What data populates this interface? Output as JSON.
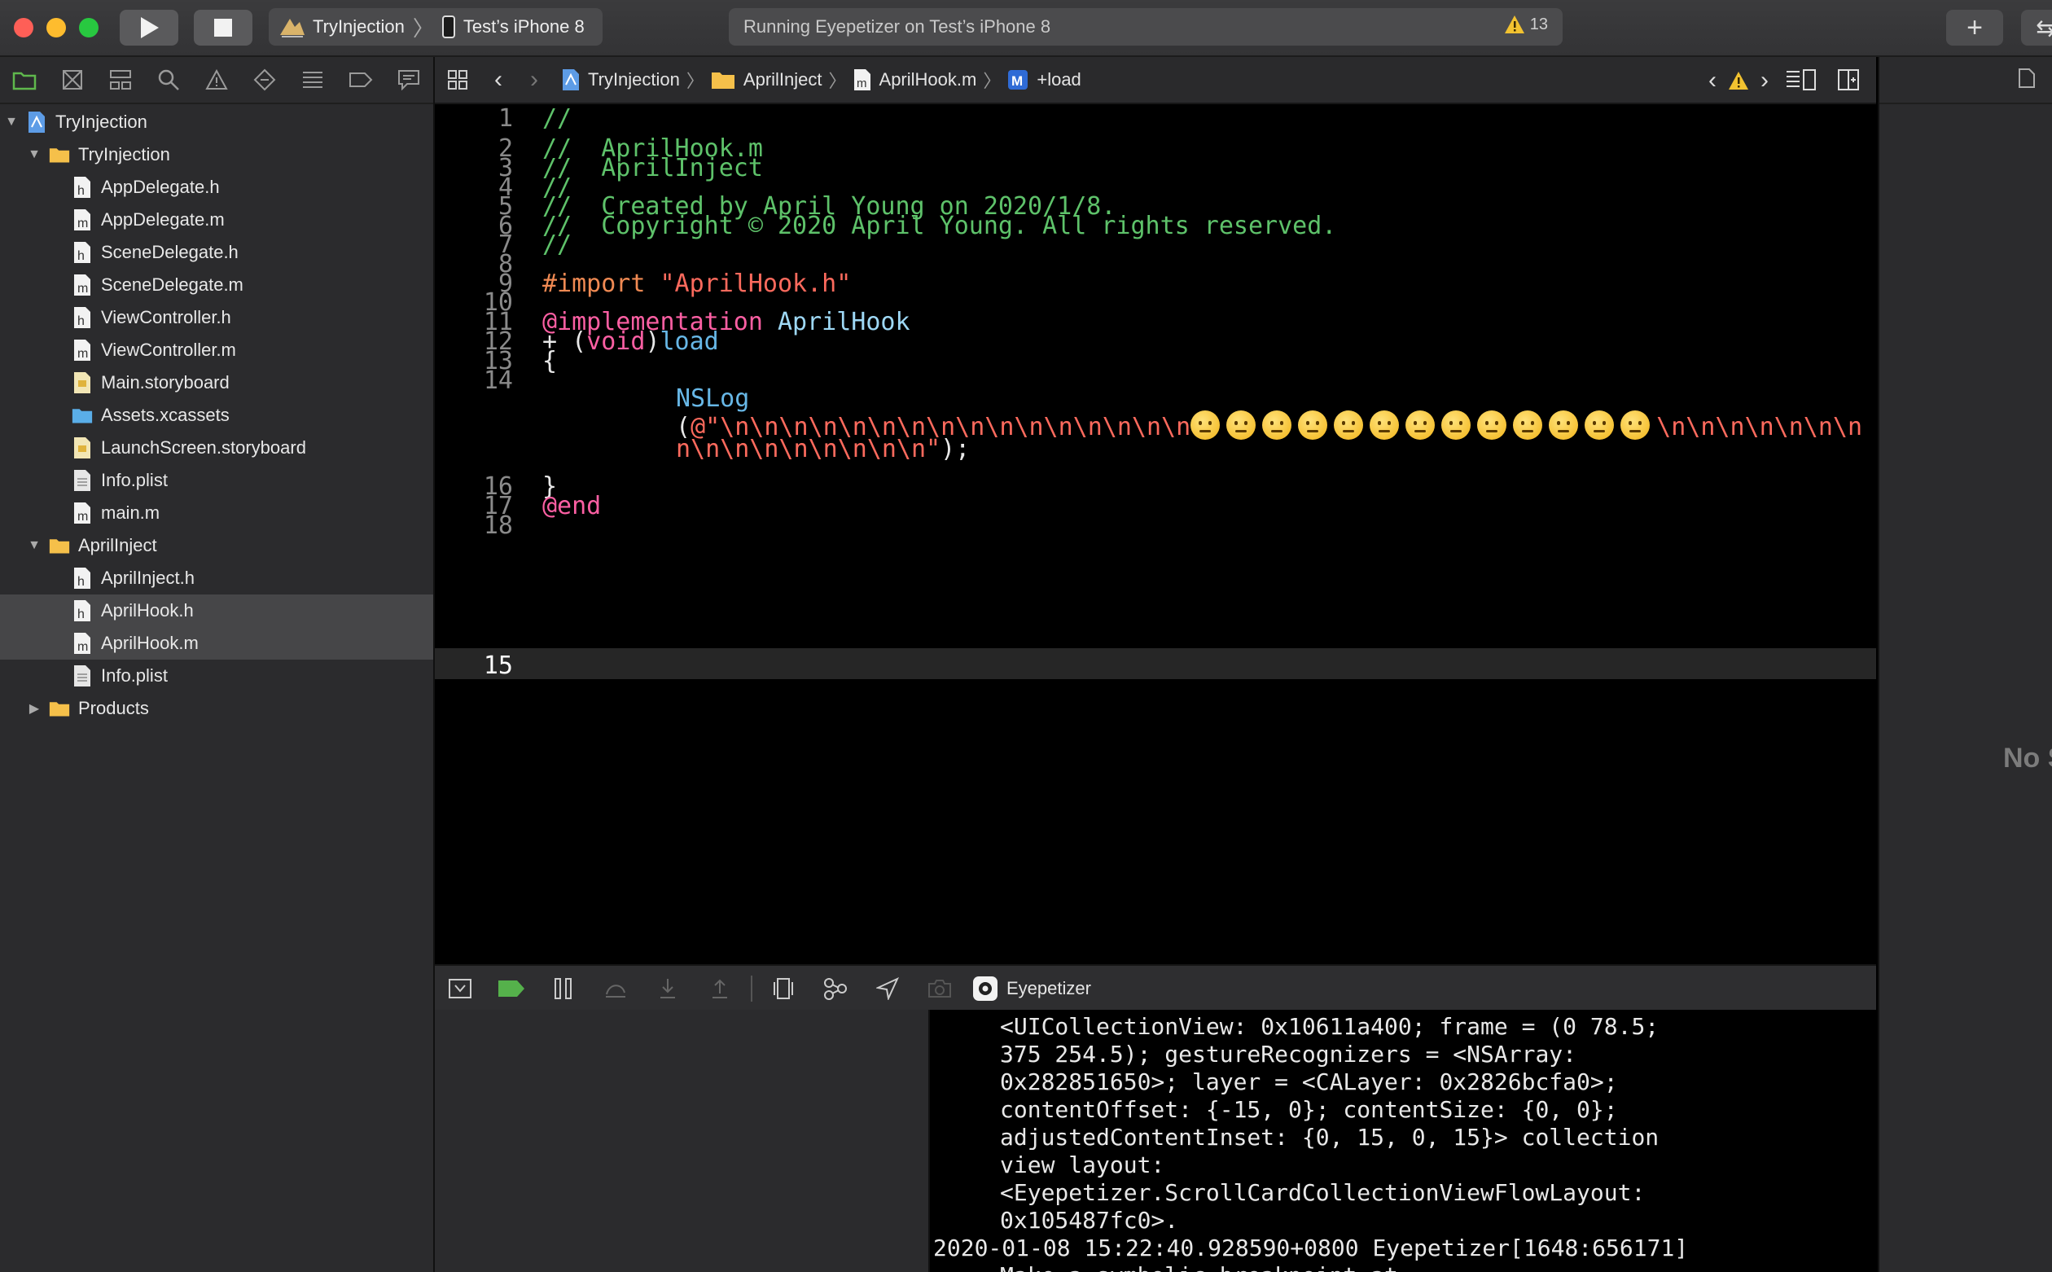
{
  "window": {
    "scheme_target": "TryInjection",
    "scheme_device": "Test’s iPhone 8",
    "activity_text": "Running Eyepetizer on Test’s iPhone 8",
    "warning_count": "13"
  },
  "sidebar": {
    "items": [
      {
        "label": "TryInjection",
        "type": "project",
        "depth": 0,
        "disclosure": "open"
      },
      {
        "label": "TryInjection",
        "type": "folder",
        "depth": 1,
        "disclosure": "open"
      },
      {
        "label": "AppDelegate.h",
        "type": "h",
        "depth": 2
      },
      {
        "label": "AppDelegate.m",
        "type": "m",
        "depth": 2
      },
      {
        "label": "SceneDelegate.h",
        "type": "h",
        "depth": 2
      },
      {
        "label": "SceneDelegate.m",
        "type": "m",
        "depth": 2
      },
      {
        "label": "ViewController.h",
        "type": "h",
        "depth": 2
      },
      {
        "label": "ViewController.m",
        "type": "m",
        "depth": 2
      },
      {
        "label": "Main.storyboard",
        "type": "storyboard",
        "depth": 2
      },
      {
        "label": "Assets.xcassets",
        "type": "assets",
        "depth": 2
      },
      {
        "label": "LaunchScreen.storyboard",
        "type": "storyboard",
        "depth": 2
      },
      {
        "label": "Info.plist",
        "type": "plist",
        "depth": 2
      },
      {
        "label": "main.m",
        "type": "m",
        "depth": 2
      },
      {
        "label": "AprilInject",
        "type": "folder",
        "depth": 1,
        "disclosure": "open"
      },
      {
        "label": "AprilInject.h",
        "type": "h",
        "depth": 2
      },
      {
        "label": "AprilHook.h",
        "type": "h",
        "depth": 2,
        "selected": true
      },
      {
        "label": "AprilHook.m",
        "type": "m",
        "depth": 2,
        "selected": true
      },
      {
        "label": "Info.plist",
        "type": "plist",
        "depth": 2
      },
      {
        "label": "Products",
        "type": "folder",
        "depth": 1,
        "disclosure": "closed"
      }
    ]
  },
  "jumpbar": {
    "crumbs": [
      "TryInjection",
      "AprilInject",
      "AprilHook.m",
      "+load"
    ]
  },
  "editor": {
    "line_numbers": [
      "1",
      "2",
      "3",
      "4",
      "5",
      "6",
      "7",
      "8",
      "9",
      "10",
      "11",
      "12",
      "13",
      "14",
      "15",
      "16",
      "17",
      "18"
    ],
    "current_line": "15",
    "comment_lines": [
      "//",
      "//  AprilHook.m",
      "//  AprilInject",
      "//",
      "//  Created by April Young on 2020/1/8.",
      "//  Copyright © 2020 April Young. All rights reserved.",
      "//"
    ],
    "import_kw": "#import",
    "import_file": "\"AprilHook.h\"",
    "impl_kw": "@implementation",
    "class_name": "AprilHook",
    "method_plus": "+ (",
    "method_void": "void",
    "method_close": ")",
    "method_name": "load",
    "open_brace": "{",
    "nslog": "NSLog",
    "string_open": "(",
    "string_at": "@\"\\n\\n\\n\\n\\n\\n\\n\\n\\n\\n\\n\\n\\n\\n\\n\\n",
    "string_mid": "\\n\\n\\n\\n\\n\\n\\n",
    "string_cont": "n\\n\\n\\n\\n\\n\\n\\n\\n\"",
    "string_end": ");",
    "emoji_count": 13,
    "close_brace": "}",
    "end_kw": "@end"
  },
  "debug": {
    "process_name": "Eyepetizer"
  },
  "console": {
    "lines": [
      "<UICollectionView: 0x10611a400; frame = (0 78.5;",
      "375 254.5); gestureRecognizers = <NSArray:",
      "0x282851650>; layer = <CALayer: 0x2826bcfa0>;",
      "contentOffset: {-15, 0}; contentSize: {0, 0};",
      "adjustedContentInset: {0, 15, 0, 15}> collection",
      "view layout:",
      "<Eyepetizer.ScrollCardCollectionViewFlowLayout:",
      "0x105487fc0>.",
      "2020-01-08 15:22:40.928590+0800 Eyepetizer[1648:656171]",
      "Make a symbolic breakpoint at"
    ]
  },
  "inspector": {
    "no_selection": "No S"
  },
  "colors": {
    "comment": "#5ec26a",
    "string": "#fc6a5d",
    "keyword": "#fc5fa3",
    "preprocessor": "#f08a53",
    "class": "#9ed8f5",
    "function": "#67b7e6"
  }
}
